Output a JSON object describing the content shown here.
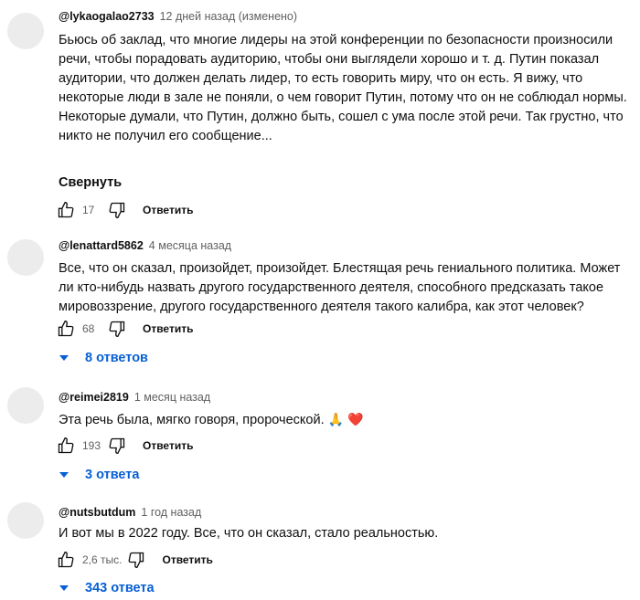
{
  "comments": [
    {
      "author": "@lykaogalao2733",
      "time": "12 дней назад (изменено)",
      "text": "Бьюсь об заклад, что многие лидеры на этой конференции по безопасности произносили речи, чтобы порадовать аудиторию, чтобы они выглядели хорошо и т. д. Путин показал аудитории, что должен делать лидер, то есть говорить миру, что он есть. Я вижу, что некоторые люди в зале не поняли, о чем говорит Путин, потому что он не соблюдал нормы. Некоторые думали, что Путин, должно быть, сошел с ума после этой речи. Так грустно, что никто не получил его сообщение...",
      "collapse_label": "Свернуть",
      "likes": "17",
      "reply_label": "Ответить"
    },
    {
      "author": "@lenattard5862",
      "time": "4 месяца назад",
      "text": "Все, что он сказал, произойдет, произойдет. Блестящая речь гениального политика. Может ли кто-нибудь назвать другого государственного деятеля, способного предсказать такое мировоззрение, другого государственного деятеля такого калибра, как этот человек?",
      "likes": "68",
      "reply_label": "Ответить",
      "replies": "8 ответов"
    },
    {
      "author": "@reimei2819",
      "time": "1 месяц назад",
      "text": "Эта речь была, мягко говоря, пророческой.",
      "emoji": "🙏 ❤️",
      "likes": "193",
      "reply_label": "Ответить",
      "replies": "3 ответа"
    },
    {
      "author": "@nutsbutdum",
      "time": "1 год назад",
      "text": "И вот мы в 2022 году. Все, что он сказал, стало реальностью.",
      "likes": "2,6 тыс.",
      "reply_label": "Ответить",
      "replies": "343 ответа"
    }
  ],
  "colors": {
    "link": "#065fd4",
    "meta": "#606060",
    "text": "#0f0f0f"
  },
  "icons": [
    "like-icon",
    "dislike-icon",
    "chevron-down-icon"
  ]
}
